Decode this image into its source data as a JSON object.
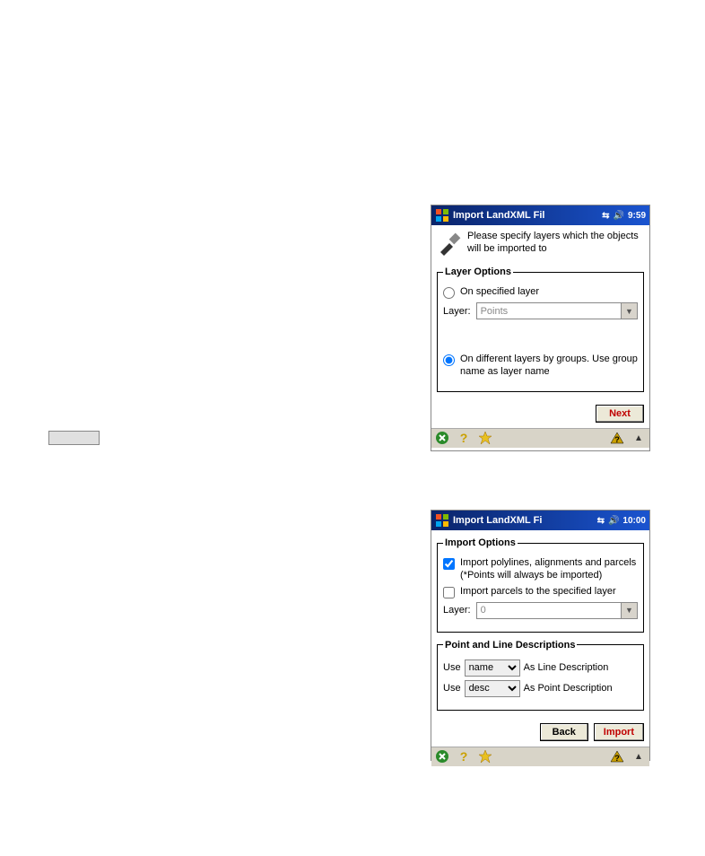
{
  "window1": {
    "title": "Import LandXML Fil",
    "time": "9:59",
    "banner_text": "Please specify layers which the objects will be imported to",
    "group_label": "Layer Options",
    "radio1_label": "On specified layer",
    "layer_label": "Layer:",
    "layer_value": "Points",
    "radio2_label": "On different layers by groups. Use group name as layer name",
    "next_label": "Next"
  },
  "window2": {
    "title": "Import LandXML Fi",
    "time": "10:00",
    "group1_label": "Import Options",
    "check1_label": "Import polylines, alignments and parcels\n(*Points will always be imported)",
    "check2_label": "Import parcels to the specified layer",
    "layer_label": "Layer:",
    "layer_value": "0",
    "group2_label": "Point and Line Descriptions",
    "use_label": "Use",
    "line_desc_option": "name",
    "line_desc_suffix": "As Line Description",
    "point_desc_option": "desc",
    "point_desc_suffix": "As Point Description",
    "back_label": "Back",
    "import_label": "Import"
  }
}
